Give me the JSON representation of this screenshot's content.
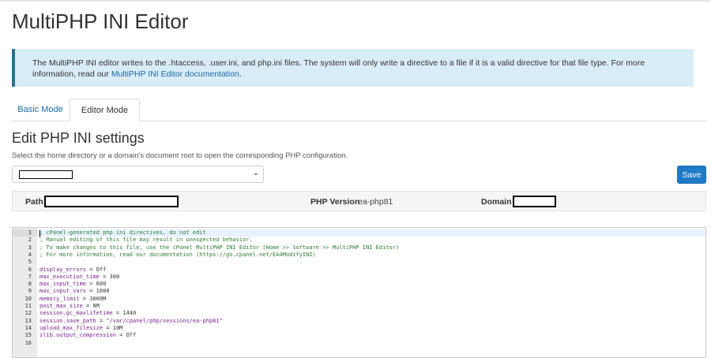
{
  "page": {
    "title": "MultiPHP INI Editor"
  },
  "info": {
    "text": "The MultiPHP INI editor writes to the .htaccess, .user.ini, and php.ini files. The system will only write a directive to a file if it is a valid directive for that file type. For more information, read our",
    "link_text": "MultiPHP INI Editor documentation",
    "suffix": "."
  },
  "tabs": [
    {
      "label": "Basic Mode",
      "active": false
    },
    {
      "label": "Editor Mode",
      "active": true
    }
  ],
  "section": {
    "title": "Edit PHP INI settings",
    "hint": "Select the home directory or a domain's document root to open the corresponding PHP configuration."
  },
  "save_label": "Save",
  "info_bar": {
    "path_label": "Path",
    "php_version_label": "PHP Version",
    "php_version_value": "ea-php81",
    "domain_label": "Domain"
  },
  "editor": {
    "lines": [
      {
        "n": "1",
        "type": "comment",
        "text": "; cPanel-generated php ini directives, do not edit"
      },
      {
        "n": "2",
        "type": "comment",
        "text": "; Manual editing of this file may result in unexpected behavior."
      },
      {
        "n": "3",
        "type": "comment",
        "text": "; To make changes to this file, use the cPanel MultiPHP INI Editor (Home >> Software >> MultiPHP INI Editor)"
      },
      {
        "n": "4",
        "type": "comment",
        "text": "; For more information, read our documentation (https://go.cpanel.net/EA4ModifyINI)"
      },
      {
        "n": "5",
        "type": "blank",
        "text": ""
      },
      {
        "n": "6",
        "type": "kv",
        "key": "display_errors",
        "val": "Off"
      },
      {
        "n": "7",
        "type": "kv",
        "key": "max_execution_time",
        "val": "300"
      },
      {
        "n": "8",
        "type": "kv",
        "key": "max_input_time",
        "val": "600"
      },
      {
        "n": "9",
        "type": "kv",
        "key": "max_input_vars",
        "val": "1000"
      },
      {
        "n": "10",
        "type": "kv",
        "key": "memory_limit",
        "val": "3000M"
      },
      {
        "n": "11",
        "type": "kv",
        "key": "post_max_size",
        "val": "8M"
      },
      {
        "n": "12",
        "type": "kv",
        "key": "session.gc_maxlifetime",
        "val": "1440"
      },
      {
        "n": "13",
        "type": "kvs",
        "key": "session.save_path",
        "val": "\"/var/cpanel/php/sessions/ea-php81\""
      },
      {
        "n": "14",
        "type": "kv",
        "key": "upload_max_filesize",
        "val": "10M"
      },
      {
        "n": "15",
        "type": "kv",
        "key": "zlib.output_compression",
        "val": "Off"
      },
      {
        "n": "16",
        "type": "blank",
        "text": ""
      }
    ]
  },
  "colors": {
    "accent": "#1f7bc6",
    "info_bg": "#d9edf7",
    "comment": "#2e7d32",
    "key": "#7a1f8c"
  }
}
